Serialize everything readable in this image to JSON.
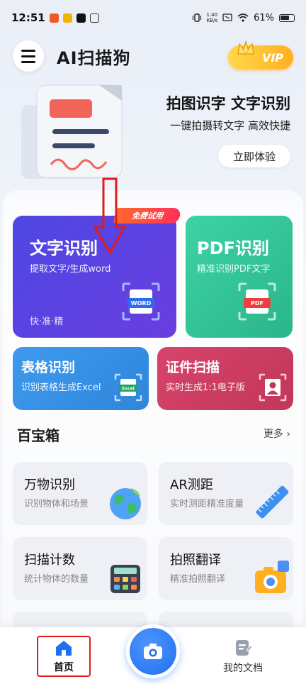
{
  "status_bar": {
    "time": "12:51",
    "net_speed_value": "1.40",
    "net_speed_unit": "KB/s",
    "battery": "61%"
  },
  "header": {
    "title": "AI扫描狗",
    "vip_label": "VIP"
  },
  "banner": {
    "title": "拍图识字 文字识别",
    "subtitle": "一键拍摄转文字 高效快捷",
    "button": "立即体验"
  },
  "features": {
    "text_recognition": {
      "badge": "免费试用",
      "title": "文字识别",
      "subtitle": "提取文字/生成word",
      "tag": "快·准·精",
      "icon_label": "WORD"
    },
    "pdf_recognition": {
      "title": "PDF识别",
      "subtitle": "精准识别PDF文字",
      "icon_label": "PDF"
    },
    "table_recognition": {
      "title": "表格识别",
      "subtitle": "识别表格生成Excel",
      "icon_label": "Excel"
    },
    "id_scan": {
      "title": "证件扫描",
      "subtitle": "实时生成1:1电子版"
    }
  },
  "toolbox": {
    "title": "百宝箱",
    "more": "更多",
    "items": [
      {
        "title": "万物识别",
        "subtitle": "识别物体和场景"
      },
      {
        "title": "AR测距",
        "subtitle": "实时测距精准度量"
      },
      {
        "title": "扫描计数",
        "subtitle": "统计物体的数量"
      },
      {
        "title": "拍照翻译",
        "subtitle": "精准拍照翻译"
      }
    ]
  },
  "bottom_nav": {
    "home": "首页",
    "docs": "我的文档"
  },
  "colors": {
    "primary_blue": "#1f6ff0",
    "text_card": "#4e47e3",
    "pdf_card": "#2bb58a",
    "table_card": "#2f86dc",
    "id_card": "#c03759",
    "annotation_red": "#e01b1b"
  }
}
